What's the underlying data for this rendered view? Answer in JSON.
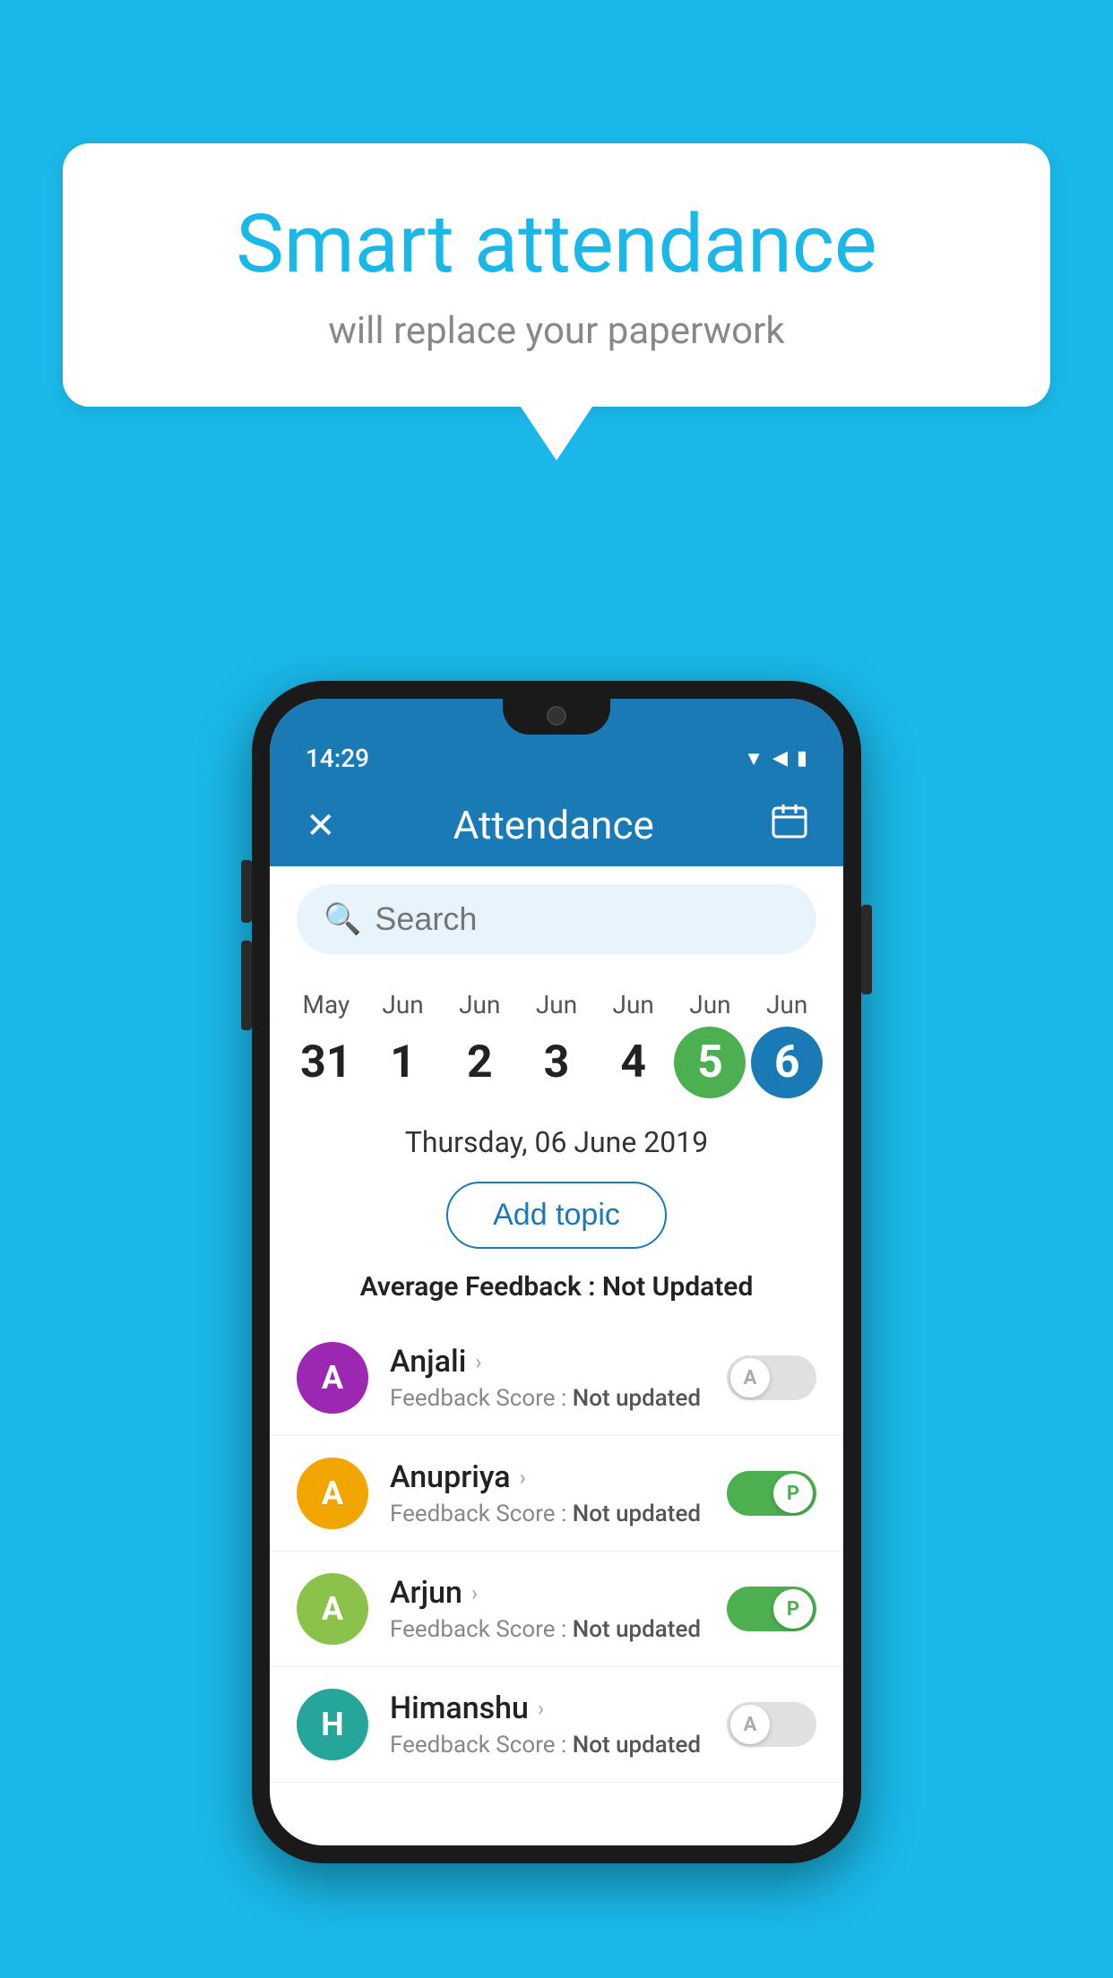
{
  "background_color": "#1ab8e8",
  "bubble": {
    "title": "Smart attendance",
    "subtitle": "will replace your paperwork"
  },
  "app": {
    "status_time": "14:29",
    "title": "Attendance",
    "close_icon": "✕",
    "calendar_icon": "📅"
  },
  "search": {
    "placeholder": "Search"
  },
  "calendar": {
    "days": [
      {
        "month": "May",
        "date": "31",
        "state": "normal"
      },
      {
        "month": "Jun",
        "date": "1",
        "state": "normal"
      },
      {
        "month": "Jun",
        "date": "2",
        "state": "normal"
      },
      {
        "month": "Jun",
        "date": "3",
        "state": "normal"
      },
      {
        "month": "Jun",
        "date": "4",
        "state": "normal"
      },
      {
        "month": "Jun",
        "date": "5",
        "state": "today"
      },
      {
        "month": "Jun",
        "date": "6",
        "state": "selected"
      }
    ]
  },
  "selected_date": "Thursday, 06 June 2019",
  "add_topic_label": "Add topic",
  "avg_feedback_label": "Average Feedback : ",
  "avg_feedback_value": "Not Updated",
  "students": [
    {
      "name": "Anjali",
      "avatar_letter": "A",
      "avatar_color": "purple",
      "feedback": "Feedback Score : ",
      "feedback_value": "Not updated",
      "attendance": "absent",
      "toggle_label": "A"
    },
    {
      "name": "Anupriya",
      "avatar_letter": "A",
      "avatar_color": "yellow",
      "feedback": "Feedback Score : ",
      "feedback_value": "Not updated",
      "attendance": "present",
      "toggle_label": "P"
    },
    {
      "name": "Arjun",
      "avatar_letter": "A",
      "avatar_color": "light-green",
      "feedback": "Feedback Score : ",
      "feedback_value": "Not updated",
      "attendance": "present",
      "toggle_label": "P"
    },
    {
      "name": "Himanshu",
      "avatar_letter": "H",
      "avatar_color": "teal",
      "feedback": "Feedback Score : ",
      "feedback_value": "Not updated",
      "attendance": "absent",
      "toggle_label": "A"
    }
  ]
}
